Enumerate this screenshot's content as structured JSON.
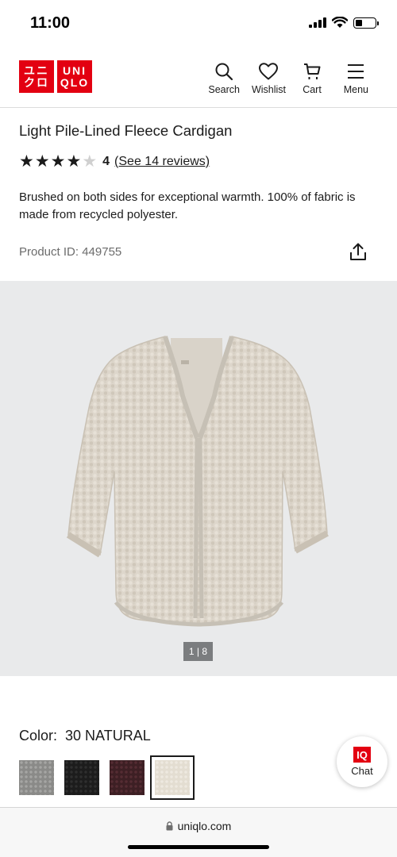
{
  "status_bar": {
    "time": "11:00"
  },
  "header": {
    "logo": {
      "line1_left": "ユニ",
      "line2_left": "クロ",
      "line1_right": "UNI",
      "line2_right": "QLO"
    },
    "nav": {
      "search": "Search",
      "wishlist": "Wishlist",
      "cart": "Cart",
      "menu": "Menu"
    }
  },
  "product": {
    "title": "Light Pile-Lined Fleece Cardigan",
    "rating_value": "4",
    "stars_filled": 4,
    "stars_total": 5,
    "reviews_link": "(See 14 reviews)",
    "description": "Brushed on both sides for exceptional warmth. 100% of fabric is made from recycled polyester.",
    "product_id": "Product ID: 449755"
  },
  "gallery": {
    "pager": "1 | 8",
    "image_subject": "beige fleece cardigan"
  },
  "color": {
    "label": "Color:",
    "value": "30 NATURAL",
    "swatches": [
      {
        "name": "gray",
        "color": "#8a8a88"
      },
      {
        "name": "black",
        "color": "#1c1c1c"
      },
      {
        "name": "dark-wine",
        "color": "#3d1f24"
      },
      {
        "name": "natural",
        "color": "#e3ddd1",
        "selected": true
      }
    ]
  },
  "chat": {
    "badge": "IQ",
    "label": "Chat"
  },
  "browser": {
    "url": "uniqlo.com"
  },
  "colors": {
    "brand_red": "#e30011",
    "gallery_bg": "#e9eaeb",
    "text": "#1b1b1b"
  }
}
